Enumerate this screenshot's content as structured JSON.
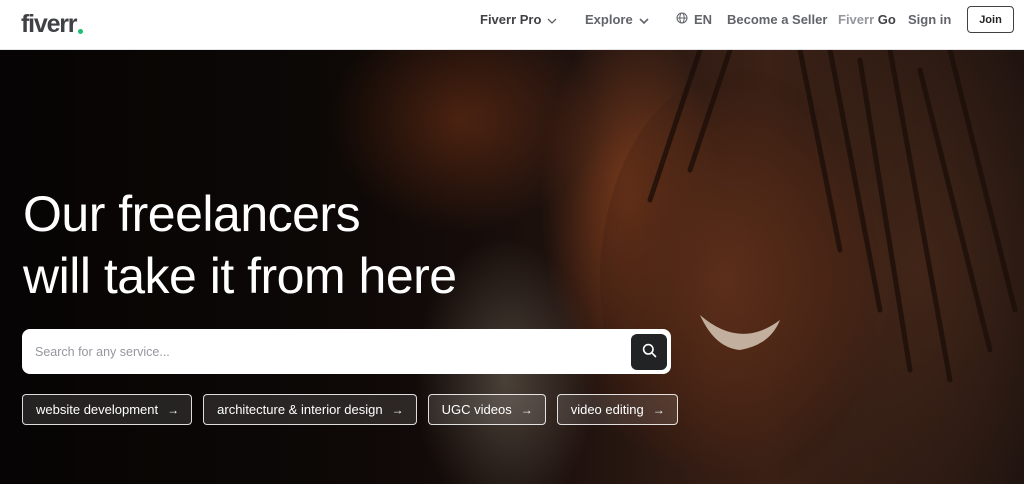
{
  "header": {
    "logo_text": "fiverr",
    "nav": {
      "fiverr_pro": "Fiverr Pro",
      "explore": "Explore",
      "language": "EN",
      "become_seller": "Become a Seller",
      "fiverr_go_part1": "Fiverr",
      "fiverr_go_part2": " Go",
      "sign_in": "Sign in",
      "join": "Join"
    }
  },
  "hero": {
    "headline_line1": "Our freelancers",
    "headline_line2": "will take it from here",
    "search": {
      "placeholder": "Search for any service..."
    },
    "chips": [
      {
        "label": "website development"
      },
      {
        "label": "architecture & interior design"
      },
      {
        "label": "UGC videos"
      },
      {
        "label": "video editing"
      }
    ]
  },
  "colors": {
    "brand_green": "#1dbf73",
    "text_dark": "#404145",
    "button_dark": "#222325"
  }
}
